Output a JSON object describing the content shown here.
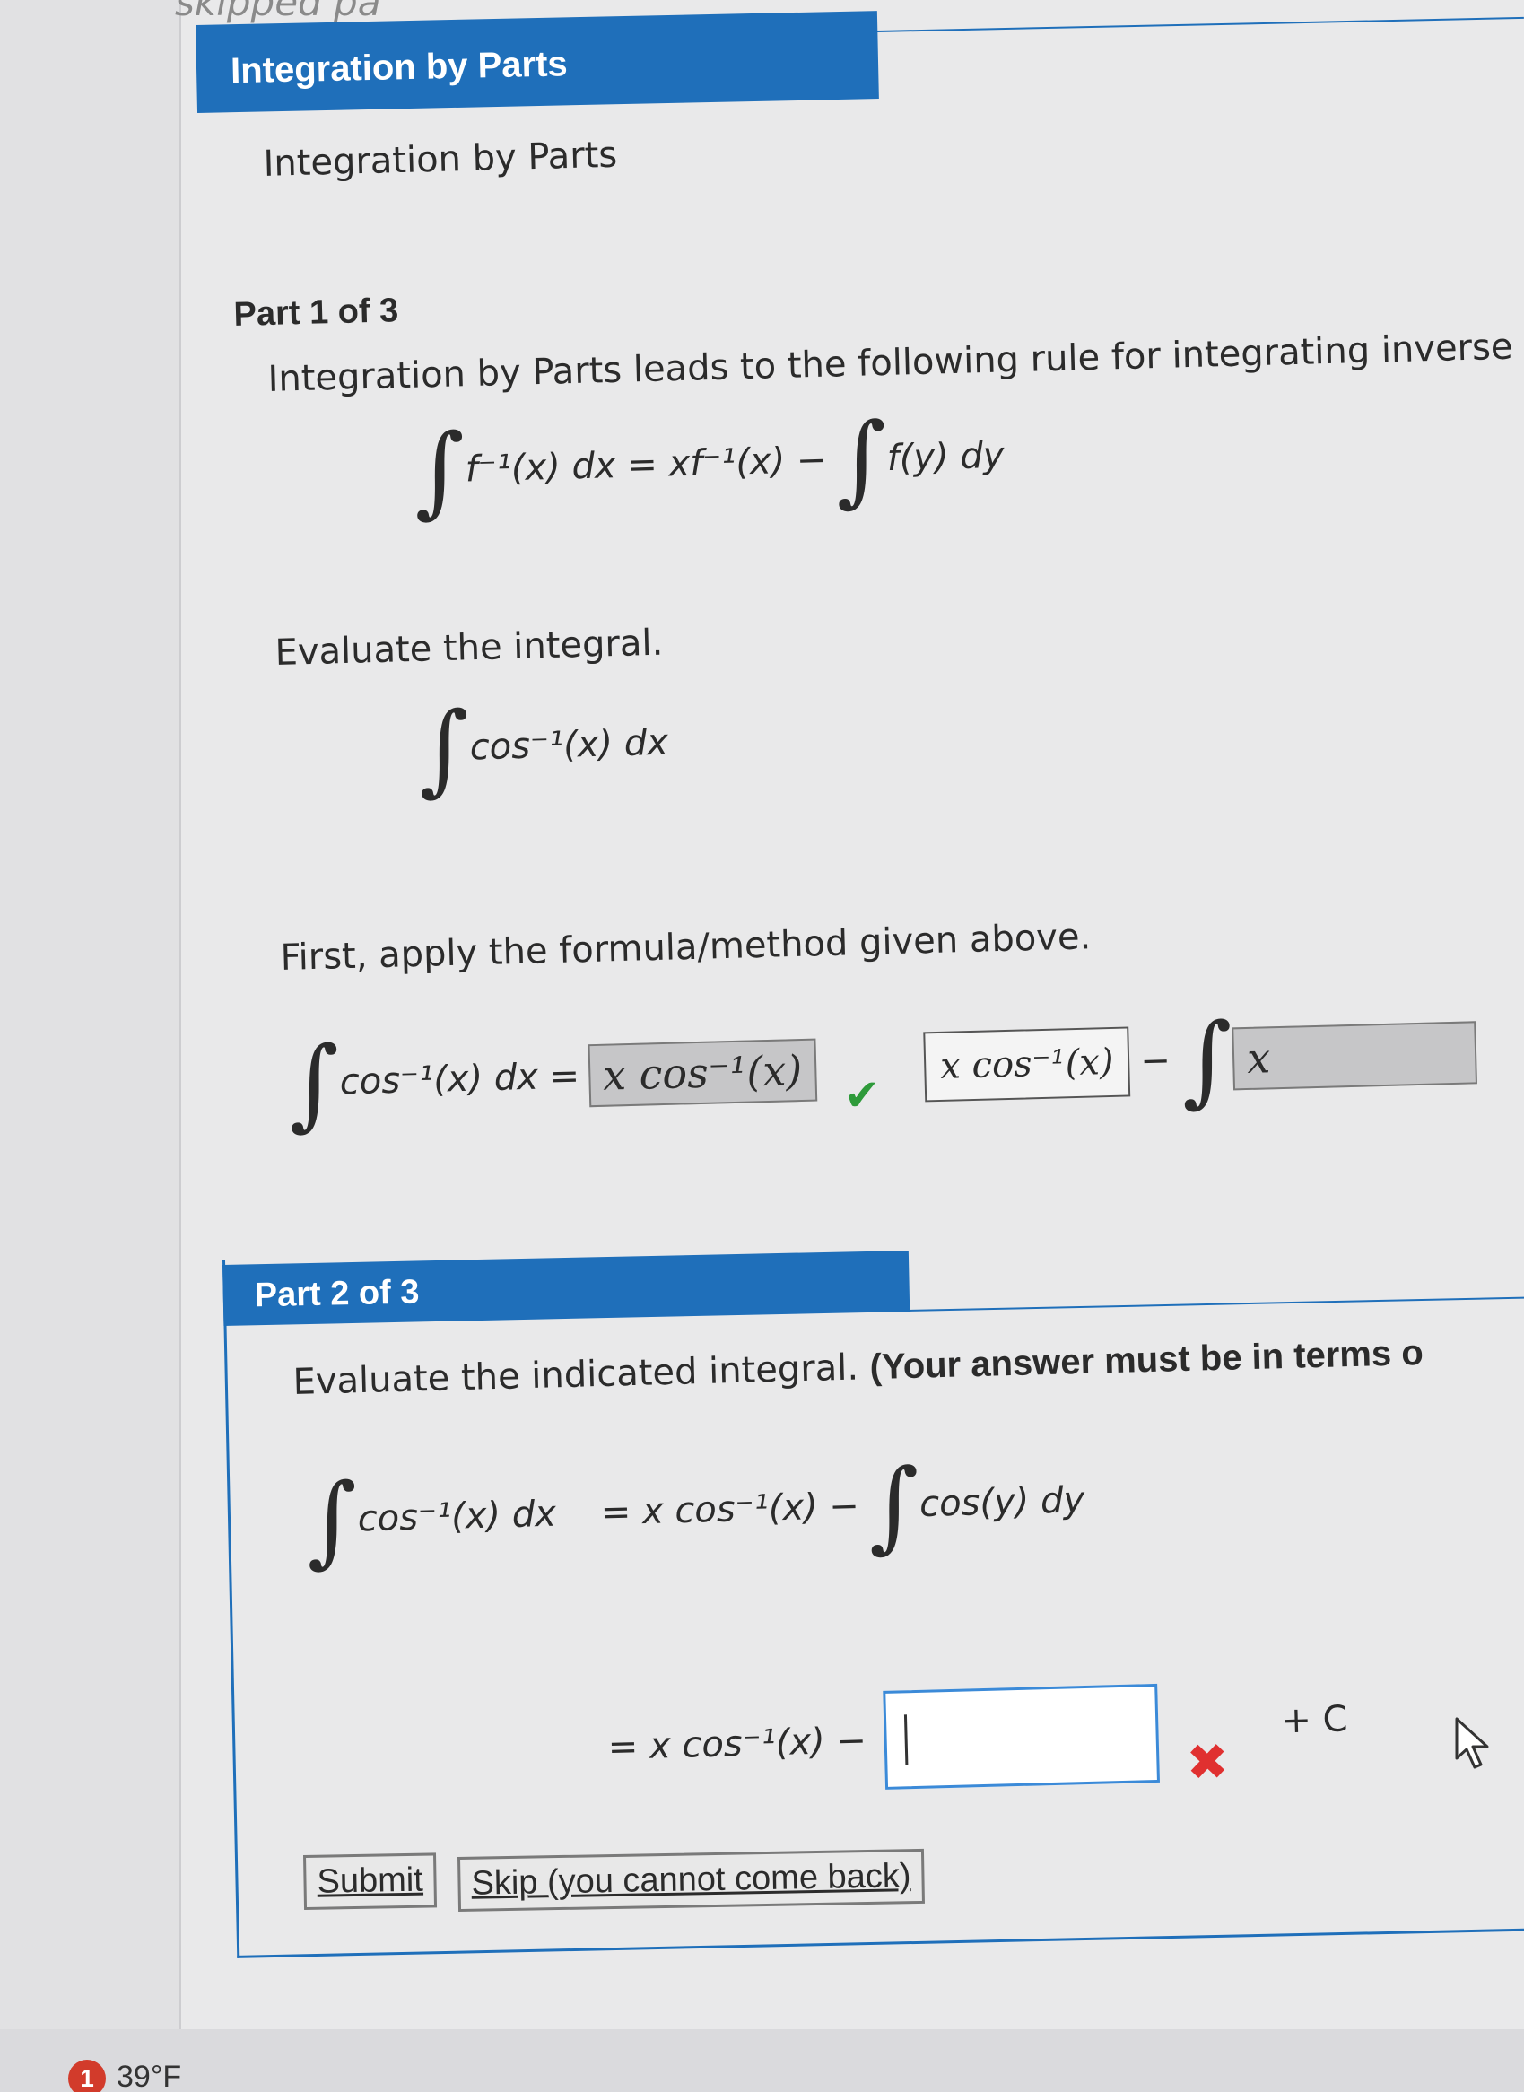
{
  "header": {
    "skipped_text": "skipped pa",
    "section_title": "Integration by Parts"
  },
  "part1": {
    "subtitle": "Integration by Parts",
    "part_label": "Part 1 of 3",
    "intro": "Integration by Parts leads to the following rule for integrating inverse f",
    "rule_lhs": "f⁻¹(x) dx = xf⁻¹(x) −",
    "rule_rhs": "f(y) dy",
    "evaluate": "Evaluate the integral.",
    "integral": "cos⁻¹(x) dx",
    "apply": "First, apply the formula/method given above.",
    "apply_lhs": "cos⁻¹(x) dx =",
    "answer1": "x cos⁻¹(x)",
    "answer2": "x cos⁻¹(x)",
    "minus": "−",
    "answer3": "x"
  },
  "part2": {
    "part_label": "Part 2 of 3",
    "instruction_plain": "Evaluate the indicated integral.",
    "instruction_bold": "(Your answer must be in terms o",
    "line1_lhs": "cos⁻¹(x) dx",
    "line1_rhs_a": "= x cos⁻¹(x) −",
    "line1_rhs_b": "cos(y) dy",
    "line2_rhs": "= x cos⁻¹(x) −",
    "input_value": "",
    "plus_c": "+ C",
    "submit_label": "Submit",
    "skip_label": "Skip (you cannot come back)"
  },
  "taskbar": {
    "badge": "1",
    "temperature": "39°F"
  },
  "icons": {
    "check": "check-icon",
    "wrong": "x-icon",
    "cursor": "mouse-pointer-icon"
  },
  "colors": {
    "header": "#1f6fba",
    "correct": "#2e9a3a",
    "wrong": "#e03030"
  }
}
